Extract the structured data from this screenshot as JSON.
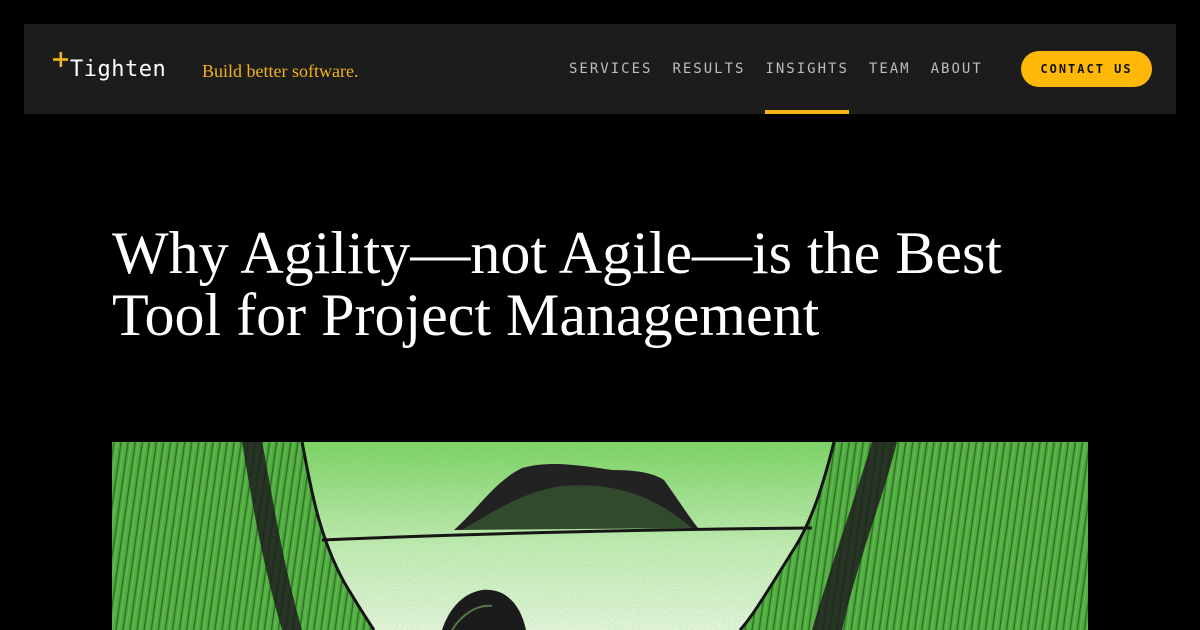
{
  "header": {
    "logo": {
      "text": "Tighten",
      "icon": "plus-icon",
      "color": "#f5b51a"
    },
    "tagline": "Build better software.",
    "nav": [
      {
        "label": "SERVICES",
        "active": false
      },
      {
        "label": "RESULTS",
        "active": false
      },
      {
        "label": "INSIGHTS",
        "active": true
      },
      {
        "label": "TEAM",
        "active": false
      },
      {
        "label": "ABOUT",
        "active": false
      }
    ],
    "cta": "CONTACT US"
  },
  "article": {
    "title": "Why Agility—not Agile—is the Best Tool for Project Management"
  },
  "hero": {
    "description_icon": "green-illustration",
    "colors": {
      "green": "#5fbf4e",
      "light": "#cdeec0",
      "ink": "#111111"
    }
  },
  "colors": {
    "accent": "#ffb808",
    "header_bg": "#1c1c1c",
    "page_bg": "#000000"
  }
}
